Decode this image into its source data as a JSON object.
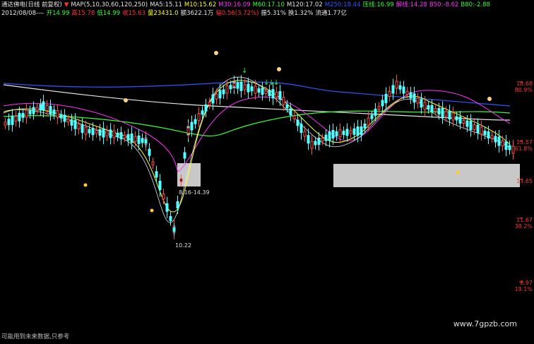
{
  "header": {
    "row1": [
      {
        "text": "通达佛电(日线 前复权)",
        "color": "#e6e6e6"
      },
      {
        "text": "▼",
        "color": "#ff3333"
      },
      {
        "text": "MAP(5,10,30,60,120,250)",
        "color": "#e6e6e6"
      },
      {
        "text": "MA5:15.11",
        "color": "#e6e6e6"
      },
      {
        "text": "M10:15.62",
        "color": "#ffff33"
      },
      {
        "text": "M30:16.09",
        "color": "#ff33ff"
      },
      {
        "text": "M60:17.10",
        "color": "#33ff33"
      },
      {
        "text": "M120:17.02",
        "color": "#e6e6e6"
      },
      {
        "text": "M250:18.44",
        "color": "#3355ff"
      },
      {
        "text": "压线:16.99",
        "color": "#33ff33"
      },
      {
        "text": "解线:14.28",
        "color": "#ff33ff"
      },
      {
        "text": "B50:-8.62",
        "color": "#ff33ff"
      },
      {
        "text": "B80:-2.88",
        "color": "#33ff33"
      }
    ],
    "row2": [
      {
        "text": "2012/08/08-—",
        "color": "#e6e6e6"
      },
      {
        "text": "开14.99",
        "color": "#33ff33"
      },
      {
        "text": "高15.78",
        "color": "#ff3333"
      },
      {
        "text": "低14.99",
        "color": "#33ff33"
      },
      {
        "text": "收15.63",
        "color": "#ff3333"
      },
      {
        "text": "量23431.0",
        "color": "#ffff33"
      },
      {
        "text": "额3622.1万",
        "color": "#e6e6e6"
      },
      {
        "text": "幅0.56(3.72%)",
        "color": "#ff3333"
      },
      {
        "text": "振5.31%",
        "color": "#e6e6e6"
      },
      {
        "text": "换1.32%",
        "color": "#e6e6e6"
      },
      {
        "text": "流通1.77亿",
        "color": "#e6e6e6"
      }
    ]
  },
  "price_axis": [
    {
      "price": "18.68",
      "pct": "80.9%",
      "price_color": "#ff3333",
      "pct_color": "#ff3333"
    },
    {
      "price": "15.57",
      "pct": "61.8%",
      "price_color": "#ff3333",
      "pct_color": "#ff3333"
    },
    {
      "price": "13.65",
      "pct": "",
      "price_color": "#ff3333",
      "pct_color": "#ff3333"
    },
    {
      "price": "11.67",
      "pct": "38.2%",
      "price_color": "#ff3333",
      "pct_color": "#ff3333"
    },
    {
      "price": "8.97",
      "pct": "19.1%",
      "price_color": "#ff3333",
      "pct_color": "#ff3333"
    }
  ],
  "annotations": {
    "range_label": "8.16-14.39",
    "low_label": "10.22"
  },
  "footer_text": "可能用到未来数据,只参考",
  "watermark": "www.7gpzb.com"
}
